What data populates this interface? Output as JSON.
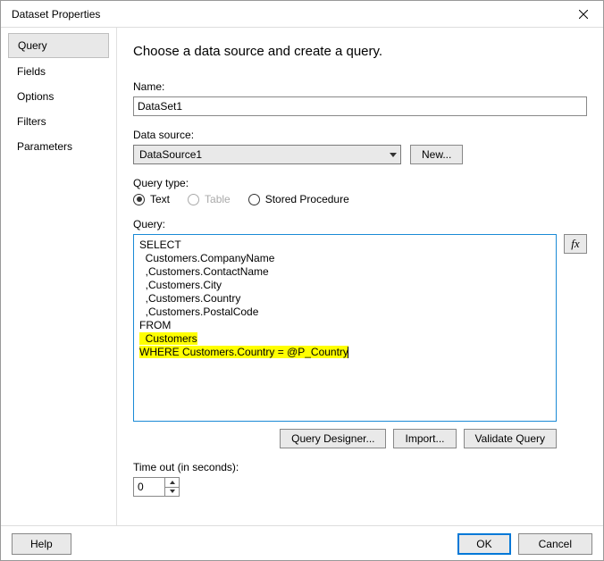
{
  "window": {
    "title": "Dataset Properties"
  },
  "sidebar": {
    "items": [
      {
        "label": "Query",
        "selected": true
      },
      {
        "label": "Fields",
        "selected": false
      },
      {
        "label": "Options",
        "selected": false
      },
      {
        "label": "Filters",
        "selected": false
      },
      {
        "label": "Parameters",
        "selected": false
      }
    ]
  },
  "main": {
    "heading": "Choose a data source and create a query.",
    "name_label": "Name:",
    "name_value": "DataSet1",
    "datasource_label": "Data source:",
    "datasource_value": "DataSource1",
    "new_btn": "New...",
    "querytype_label": "Query type:",
    "querytype_options": {
      "text": "Text",
      "table": "Table",
      "sproc": "Stored Procedure"
    },
    "querytype_selected": "text",
    "query_label": "Query:",
    "query_lines": {
      "l1": "SELECT",
      "l2": "  Customers.CompanyName",
      "l3": "  ,Customers.ContactName",
      "l4": "  ,Customers.City",
      "l5": "  ,Customers.Country",
      "l6": "  ,Customers.PostalCode",
      "l7": "FROM",
      "l8": "  Customers",
      "l9": "WHERE Customers.Country = @P_Country"
    },
    "fx_label": "fx",
    "query_designer_btn": "Query Designer...",
    "import_btn": "Import...",
    "validate_btn": "Validate Query",
    "timeout_label": "Time out (in seconds):",
    "timeout_value": "0"
  },
  "footer": {
    "help": "Help",
    "ok": "OK",
    "cancel": "Cancel"
  }
}
